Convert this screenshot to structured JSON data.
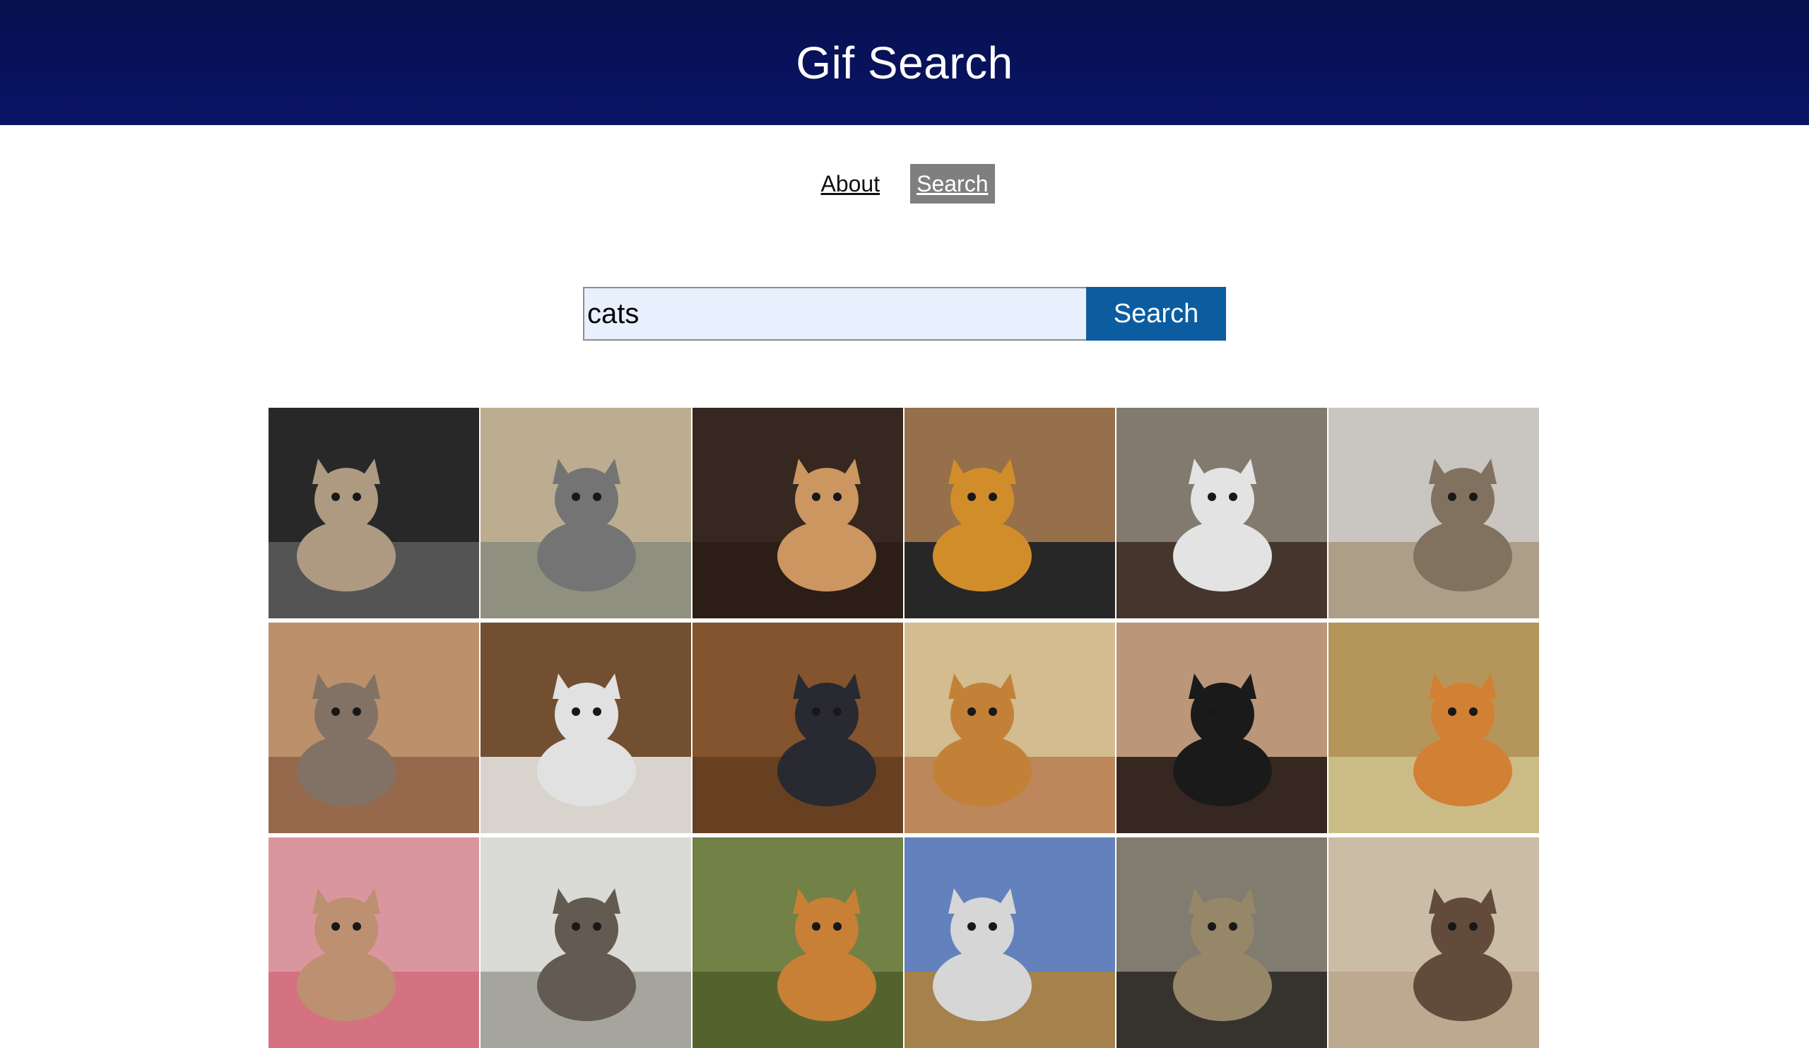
{
  "header": {
    "title": "Gif Search"
  },
  "nav": {
    "about_label": "About",
    "search_label": "Search"
  },
  "search": {
    "value": "cats",
    "button_label": "Search"
  },
  "colors": {
    "header_bg": "#05104f",
    "search_button_bg": "#0c5da0",
    "active_nav_bg": "#7f7f7f",
    "input_bg": "#e8f0fe"
  },
  "results": [
    {
      "icon": "cat-on-motorcycle-gif",
      "bg": "#2b2b2b",
      "floor": "#5a5a5a",
      "cat": "#b9a48a"
    },
    {
      "icon": "cat-lightsaber-gif",
      "bg": "#c8b89a",
      "floor": "#9a9a88",
      "cat": "#7c7c7c"
    },
    {
      "icon": "cats-on-leather-couch-gif",
      "bg": "#3a2a22",
      "floor": "#2f2018",
      "cat": "#d8a067"
    },
    {
      "icon": "cats-on-turntables-gif",
      "bg": "#a07850",
      "floor": "#2a2a2a",
      "cat": "#e0962e"
    },
    {
      "icon": "cats-cuddling-bed-gif",
      "bg": "#8c8276",
      "floor": "#4a3a30",
      "cat": "#f2f2f2"
    },
    {
      "icon": "cats-looking-up-gif",
      "bg": "#d6d2cc",
      "floor": "#b8a890",
      "cat": "#8a7a66"
    },
    {
      "icon": "kitten-with-tablet-gif",
      "bg": "#c89a72",
      "floor": "#a07052",
      "cat": "#8a7a6c"
    },
    {
      "icon": "cats-in-shelf-gif",
      "bg": "#7a5434",
      "floor": "#e6e2da",
      "cat": "#f0f0f0"
    },
    {
      "icon": "cat-on-mop-gif",
      "bg": "#8c5a30",
      "floor": "#6e4424",
      "cat": "#2c2c36"
    },
    {
      "icon": "cat-with-ears-gif",
      "bg": "#e0c89a",
      "floor": "#c89060",
      "cat": "#d08a3c"
    },
    {
      "icon": "black-cat-glasses-gif",
      "bg": "#c8a080",
      "floor": "#3a2a24",
      "cat": "#1c1c1c"
    },
    {
      "icon": "orange-cat-pillow-gif",
      "bg": "#c0a060",
      "floor": "#d8c890",
      "cat": "#e08838"
    },
    {
      "icon": "cats-in-pink-blanket-gif",
      "bg": "#e8a0a8",
      "floor": "#e27a8a",
      "cat": "#c89a78"
    },
    {
      "icon": "cat-outdoor-door-gif",
      "bg": "#e8e8e4",
      "floor": "#b0b0a8",
      "cat": "#6a6058"
    },
    {
      "icon": "cat-and-pig-gif",
      "bg": "#7a8a4a",
      "floor": "#5a6a30",
      "cat": "#d4883a"
    },
    {
      "icon": "cat-sunglasses-field-gif",
      "bg": "#6a8ac8",
      "floor": "#b08a50",
      "cat": "#e4e4e4"
    },
    {
      "icon": "rat-hallway-gif",
      "bg": "#8a8478",
      "floor": "#3a3630",
      "cat": "#a09070"
    },
    {
      "icon": "cat-in-toilet-gif",
      "bg": "#d8c8b0",
      "floor": "#c8b498",
      "cat": "#6a5040"
    }
  ]
}
